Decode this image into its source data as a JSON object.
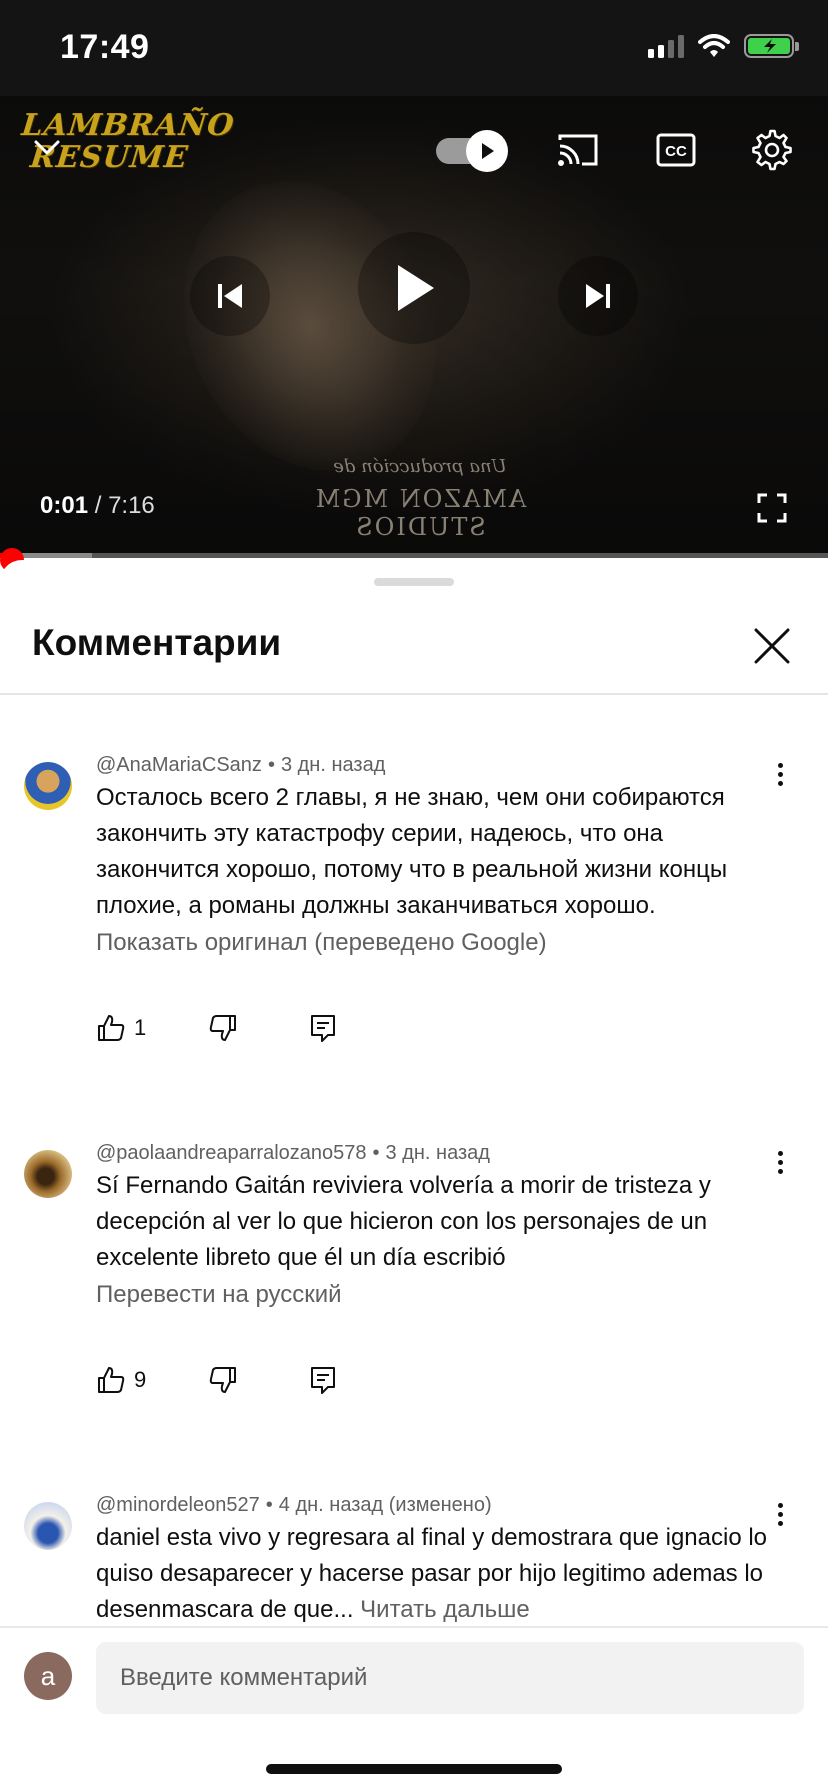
{
  "status_bar": {
    "time": "17:49"
  },
  "player": {
    "channel_logo_line1": "LAMBRAÑO",
    "channel_logo_line2": "RESUME",
    "current_time": "0:01",
    "separator": " / ",
    "duration": "7:16",
    "credit_line1": "Una producción de",
    "credit_line2": "AMAZON MGM STUDIOS",
    "autoplay_on": true,
    "progress_fraction": 0.002
  },
  "sheet": {
    "title": "Комментарии"
  },
  "comments": [
    {
      "author": "@AnaMariaCSanz",
      "time": "3 дн. назад",
      "text": "Осталось всего 2 главы, я не знаю, чем они собираются закончить эту катастрофу серии, надеюсь, что она закончится хорошо, потому что в реальной жизни концы плохие, а романы должны заканчиваться хорошо.",
      "translate_link": "Показать оригинал (переведено Google)",
      "likes": "1"
    },
    {
      "author": "@paolaandreaparralozano578",
      "time": "3 дн. назад",
      "text": "Sí Fernando Gaitán reviviera volvería a morir de tristeza y decepción al ver lo que hicieron con los personajes de un excelente libreto que él un día escribió",
      "translate_link": "Перевести на русский",
      "likes": "9"
    },
    {
      "author": "@minordeleon527",
      "time": "4 дн. назад (изменено)",
      "text": "daniel esta vivo y regresara al final y demostrara que ignacio lo quiso desaparecer y hacerse pasar por hijo legitimo ademas lo desenmascara de que...",
      "read_more": "Читать дальше"
    }
  ],
  "composer": {
    "avatar_letter": "a",
    "placeholder": "Введите комментарий"
  },
  "colors": {
    "progress_played": "#ff0000",
    "battery": "#3fd14b",
    "secondary_text": "#606060"
  }
}
